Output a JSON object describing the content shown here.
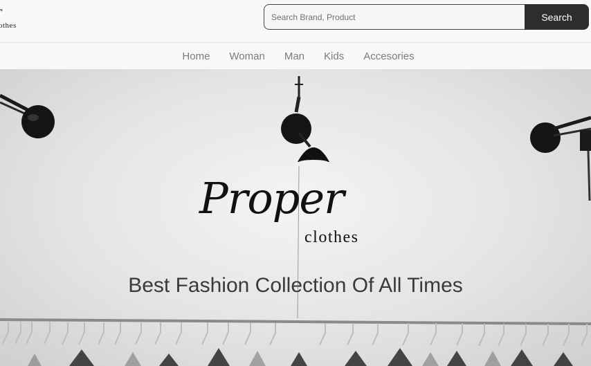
{
  "header": {
    "logo_script": "er",
    "logo_sub": "othes",
    "search_placeholder": "Search Brand, Product",
    "search_button": "Search"
  },
  "nav": {
    "links": [
      "Home",
      "Woman",
      "Man",
      "Kids",
      "Accesories"
    ]
  },
  "hero": {
    "brand_script": "Proper",
    "brand_sub": "clothes",
    "tagline": "Best Fashion Collection Of All Times"
  }
}
